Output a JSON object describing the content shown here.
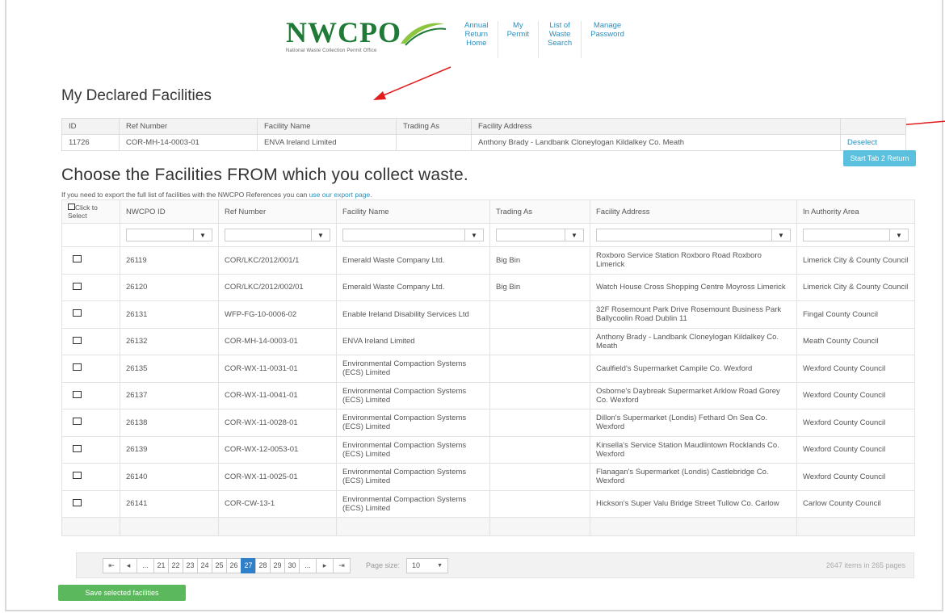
{
  "header": {
    "logo_text": "NWCPO",
    "logo_tagline": "National Waste Collection Permit Office",
    "nav": [
      {
        "label": "Annual Return Home",
        "lines": [
          "Annual",
          "Return",
          "Home"
        ]
      },
      {
        "label": "My Permit",
        "lines": [
          "My",
          "Permit"
        ]
      },
      {
        "label": "List of Waste Search",
        "lines": [
          "List of",
          "Waste",
          "Search"
        ]
      },
      {
        "label": "Manage Password",
        "lines": [
          "Manage",
          "Password"
        ]
      }
    ]
  },
  "declared": {
    "title": "My Declared Facilities",
    "columns": [
      "ID",
      "Ref Number",
      "Facility Name",
      "Trading As",
      "Facility Address",
      ""
    ],
    "rows": [
      {
        "id": "11726",
        "ref": "COR-MH-14-0003-01",
        "name": "ENVA Ireland Limited",
        "trading": "",
        "address": "Anthony Brady - Landbank Cloneylogan Kildalkey Co. Meath",
        "action": "Deselect"
      }
    ],
    "start_button": "Start Tab 2 Return"
  },
  "choose": {
    "title": "Choose the Facilities FROM which you collect waste.",
    "export_note": "If you need to export the full list of facilities with the NWCPO References you can ",
    "export_link": "use our export page.",
    "columns": {
      "select": "Click to Select",
      "nwcpo_id": "NWCPO ID",
      "ref": "Ref Number",
      "name": "Facility Name",
      "trading": "Trading As",
      "address": "Facility Address",
      "authority": "In Authority Area"
    },
    "rows": [
      {
        "id": "26119",
        "ref": "COR/LKC/2012/001/1",
        "name": "Emerald Waste Company Ltd.",
        "trading": "Big Bin",
        "address": "Roxboro Service Station Roxboro Road Roxboro Limerick",
        "authority": "Limerick City & County Council"
      },
      {
        "id": "26120",
        "ref": "COR/LKC/2012/002/01",
        "name": "Emerald Waste Company Ltd.",
        "trading": "Big Bin",
        "address": "Watch House Cross Shopping Centre Moyross Limerick",
        "authority": "Limerick City & County Council"
      },
      {
        "id": "26131",
        "ref": "WFP-FG-10-0006-02",
        "name": "Enable Ireland Disability Services Ltd",
        "trading": "",
        "address": "32F Rosemount Park Drive Rosemount Business Park Ballycoolin Road Dublin 11",
        "authority": "Fingal County Council"
      },
      {
        "id": "26132",
        "ref": "COR-MH-14-0003-01",
        "name": "ENVA Ireland Limited",
        "trading": "",
        "address": "Anthony Brady - Landbank Cloneylogan Kildalkey Co. Meath",
        "authority": "Meath County Council"
      },
      {
        "id": "26135",
        "ref": "COR-WX-11-0031-01",
        "name": "Environmental Compaction Systems (ECS) Limited",
        "trading": "",
        "address": "Caulfield's Supermarket Campile Co. Wexford",
        "authority": "Wexford County Council"
      },
      {
        "id": "26137",
        "ref": "COR-WX-11-0041-01",
        "name": "Environmental Compaction Systems (ECS) Limited",
        "trading": "",
        "address": "Osborne's Daybreak Supermarket Arklow Road Gorey Co. Wexford",
        "authority": "Wexford County Council"
      },
      {
        "id": "26138",
        "ref": "COR-WX-11-0028-01",
        "name": "Environmental Compaction Systems (ECS) Limited",
        "trading": "",
        "address": "Dillon's Supermarket (Londis) Fethard On Sea Co. Wexford",
        "authority": "Wexford County Council"
      },
      {
        "id": "26139",
        "ref": "COR-WX-12-0053-01",
        "name": "Environmental Compaction Systems (ECS) Limited",
        "trading": "",
        "address": "Kinsella's Service Station Maudlintown Rocklands Co. Wexford",
        "authority": "Wexford County Council"
      },
      {
        "id": "26140",
        "ref": "COR-WX-11-0025-01",
        "name": "Environmental Compaction Systems (ECS) Limited",
        "trading": "",
        "address": "Flanagan's Supermarket (Londis) Castlebridge Co. Wexford",
        "authority": "Wexford County Council"
      },
      {
        "id": "26141",
        "ref": "COR-CW-13-1",
        "name": "Environmental Compaction Systems (ECS) Limited",
        "trading": "",
        "address": "Hickson's Super Valu Bridge Street Tullow Co. Carlow",
        "authority": "Carlow County Council"
      }
    ]
  },
  "pager": {
    "first": "⇤",
    "prev": "◂",
    "ellipsis": "...",
    "pages": [
      "21",
      "22",
      "23",
      "24",
      "25",
      "26",
      "27",
      "28",
      "29",
      "30"
    ],
    "active_page": "27",
    "next": "▸",
    "last": "⇥",
    "page_size_label": "Page size:",
    "page_size": "10",
    "info": "2647 items in 265 pages"
  },
  "save_button": "Save selected facilities",
  "colors": {
    "brand_green": "#1e7a36",
    "link_blue": "#2a8fbd",
    "info_button": "#5bc0de",
    "save_button": "#5cb85c",
    "active_page": "#2f7fc9",
    "annotation_arrow": "#e21b1b"
  }
}
